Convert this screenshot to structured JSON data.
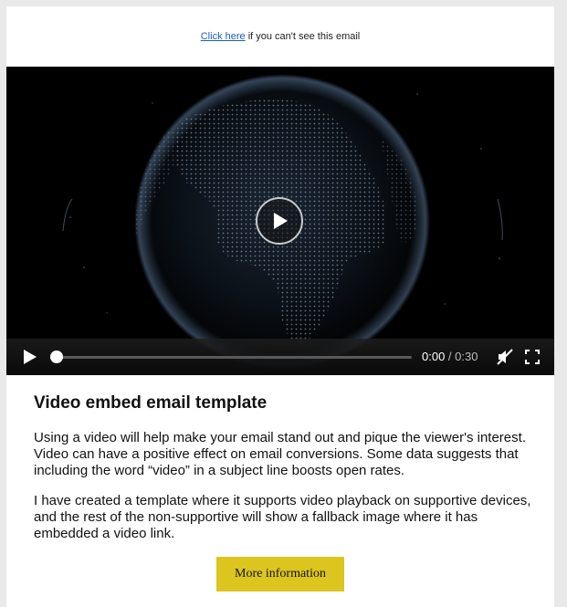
{
  "preheader": {
    "link_text": "Click here",
    "suffix_text": " if you can't see this email"
  },
  "video": {
    "current_time": "0:00",
    "separator": " / ",
    "duration": "0:30",
    "progress_fraction": 0,
    "icons": {
      "play_overlay": "play-icon",
      "play_control": "play-icon",
      "mute": "volume-muted-icon",
      "fullscreen": "fullscreen-icon"
    }
  },
  "article": {
    "title": "Video embed email template",
    "paragraph_1": "Using a video will help make your email stand out and pique the viewer's interest. Video can have a positive effect on email conversions. Some data suggests that including the word “video” in a subject line boosts open rates.",
    "paragraph_2": "I have created a template where it supports video playback on supportive devices, and the rest of the non-supportive will show a fallback image where it has embedded a video link."
  },
  "cta": {
    "label": "More information",
    "color": "#dcc51f"
  }
}
